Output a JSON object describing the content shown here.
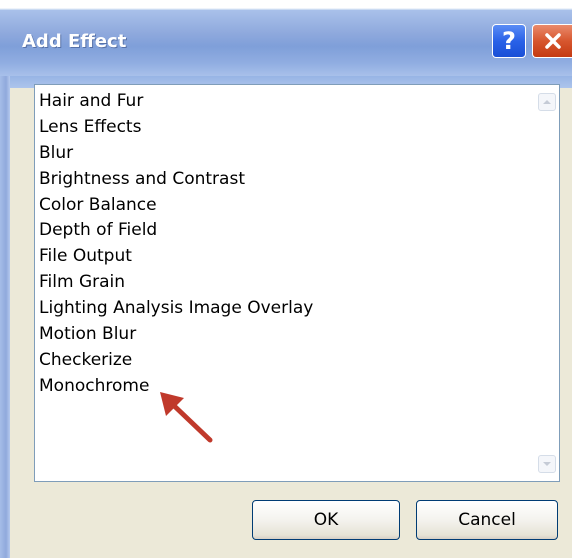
{
  "window": {
    "title": "Add Effect",
    "help_glyph": "?",
    "help_icon": "question-mark-icon",
    "close_icon": "close-x-icon"
  },
  "effects_list": {
    "items": [
      "Hair and Fur",
      "Lens Effects",
      "Blur",
      "Brightness and Contrast",
      "Color Balance",
      "Depth of Field",
      "File Output",
      "Film Grain",
      "Lighting Analysis Image Overlay",
      "Motion Blur",
      "Checkerize",
      "Monochrome"
    ]
  },
  "annotation": {
    "icon": "red-arrow-pointer-icon",
    "color": "#c0392b"
  },
  "buttons": {
    "ok_label": "OK",
    "cancel_label": "Cancel"
  }
}
